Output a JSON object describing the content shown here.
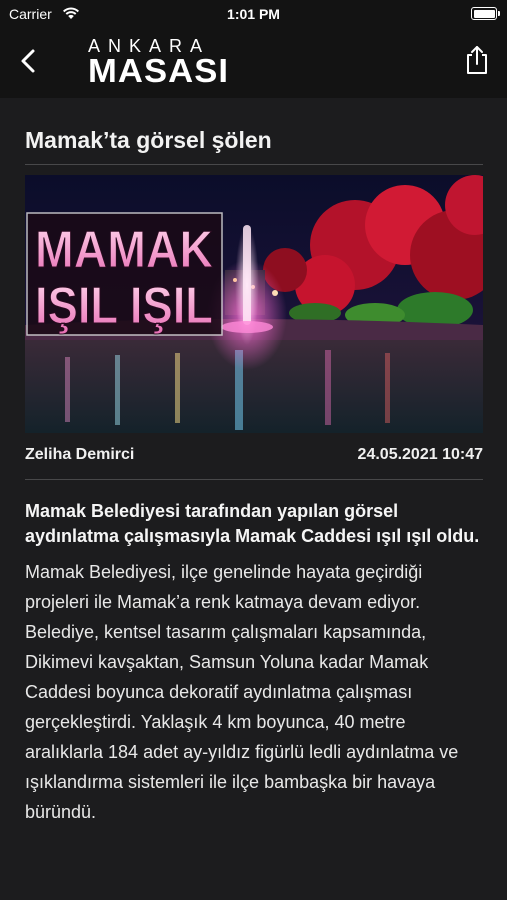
{
  "status_bar": {
    "carrier": "Carrier",
    "time": "1:01 PM"
  },
  "nav": {
    "logo_top": "ANKARA",
    "logo_bottom": "MASASI"
  },
  "article": {
    "title": "Mamak’ta görsel şölen",
    "image_overlay_line1": "MAMAK",
    "image_overlay_line2": "IŞIL IŞIL",
    "author": "Zeliha Demirci",
    "datetime": "24.05.2021 10:47",
    "lead": "Mamak Belediyesi tarafından yapılan görsel aydınlatma çalışmasıyla Mamak Caddesi ışıl ışıl oldu.",
    "body": "Mamak Belediyesi, ilçe genelinde hayata geçirdiği projeleri ile Mamak’a renk katmaya devam ediyor. Belediye, kentsel tasarım çalışmaları kapsamında, Dikimevi kavşaktan, Samsun Yoluna kadar Mamak Caddesi boyunca dekoratif aydınlatma çalışması gerçekleştirdi. Yaklaşık 4 km boyunca, 40 metre aralıklarla 184 adet ay-yıldız figürlü ledli aydınlatma ve ışıklandırma sistemleri ile ilçe bambaşka bir havaya büründü."
  }
}
